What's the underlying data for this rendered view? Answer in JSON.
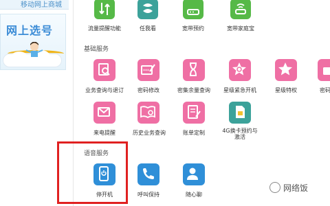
{
  "sidebar": {
    "shop_banner": "移动网上商城",
    "select_card_title": "网上选号"
  },
  "top_row": [
    {
      "label": "流量提醒功能",
      "icon": "arrows-icon",
      "color": "green"
    },
    {
      "label": "任我看",
      "icon": "china-mobile-logo",
      "color": "teal"
    },
    {
      "label": "宽带预约",
      "icon": "router-icon",
      "color": "green"
    },
    {
      "label": "宽带家庭宝",
      "icon": "wifi-router-icon",
      "color": "green"
    }
  ],
  "sections": {
    "basic": {
      "title": "基础服务",
      "row1": [
        {
          "label": "业务查询与退订",
          "icon": "search-document-icon"
        },
        {
          "label": "密码修改",
          "icon": "password-edit-icon"
        },
        {
          "label": "密集余量查询",
          "icon": "hourglass-icon"
        },
        {
          "label": "星级紧急开机",
          "icon": "star-power-icon"
        },
        {
          "label": "星级特权",
          "icon": "star-crown-icon"
        },
        {
          "label": "密码",
          "icon": "lock-icon"
        }
      ],
      "row2": [
        {
          "label": "来电提醒",
          "icon": "phone-mail-icon"
        },
        {
          "label": "历史业务查询",
          "icon": "book-search-icon"
        },
        {
          "label": "账单定制",
          "icon": "bill-edit-icon"
        },
        {
          "label": "4G换卡预约与激活",
          "icon": "sim-card-icon"
        }
      ]
    },
    "voice": {
      "title": "语音服务",
      "items": [
        {
          "label": "停开机",
          "icon": "power-phone-icon"
        },
        {
          "label": "呼叫保持",
          "icon": "call-hold-icon"
        },
        {
          "label": "随心聊",
          "icon": "contact-phone-icon"
        }
      ]
    }
  },
  "watermark": "网络饭",
  "colors": {
    "pink": "#ef6fa4",
    "green": "#56b947",
    "teal": "#3ca29a",
    "blue": "#2f8fd8",
    "highlight": "#e02020"
  }
}
